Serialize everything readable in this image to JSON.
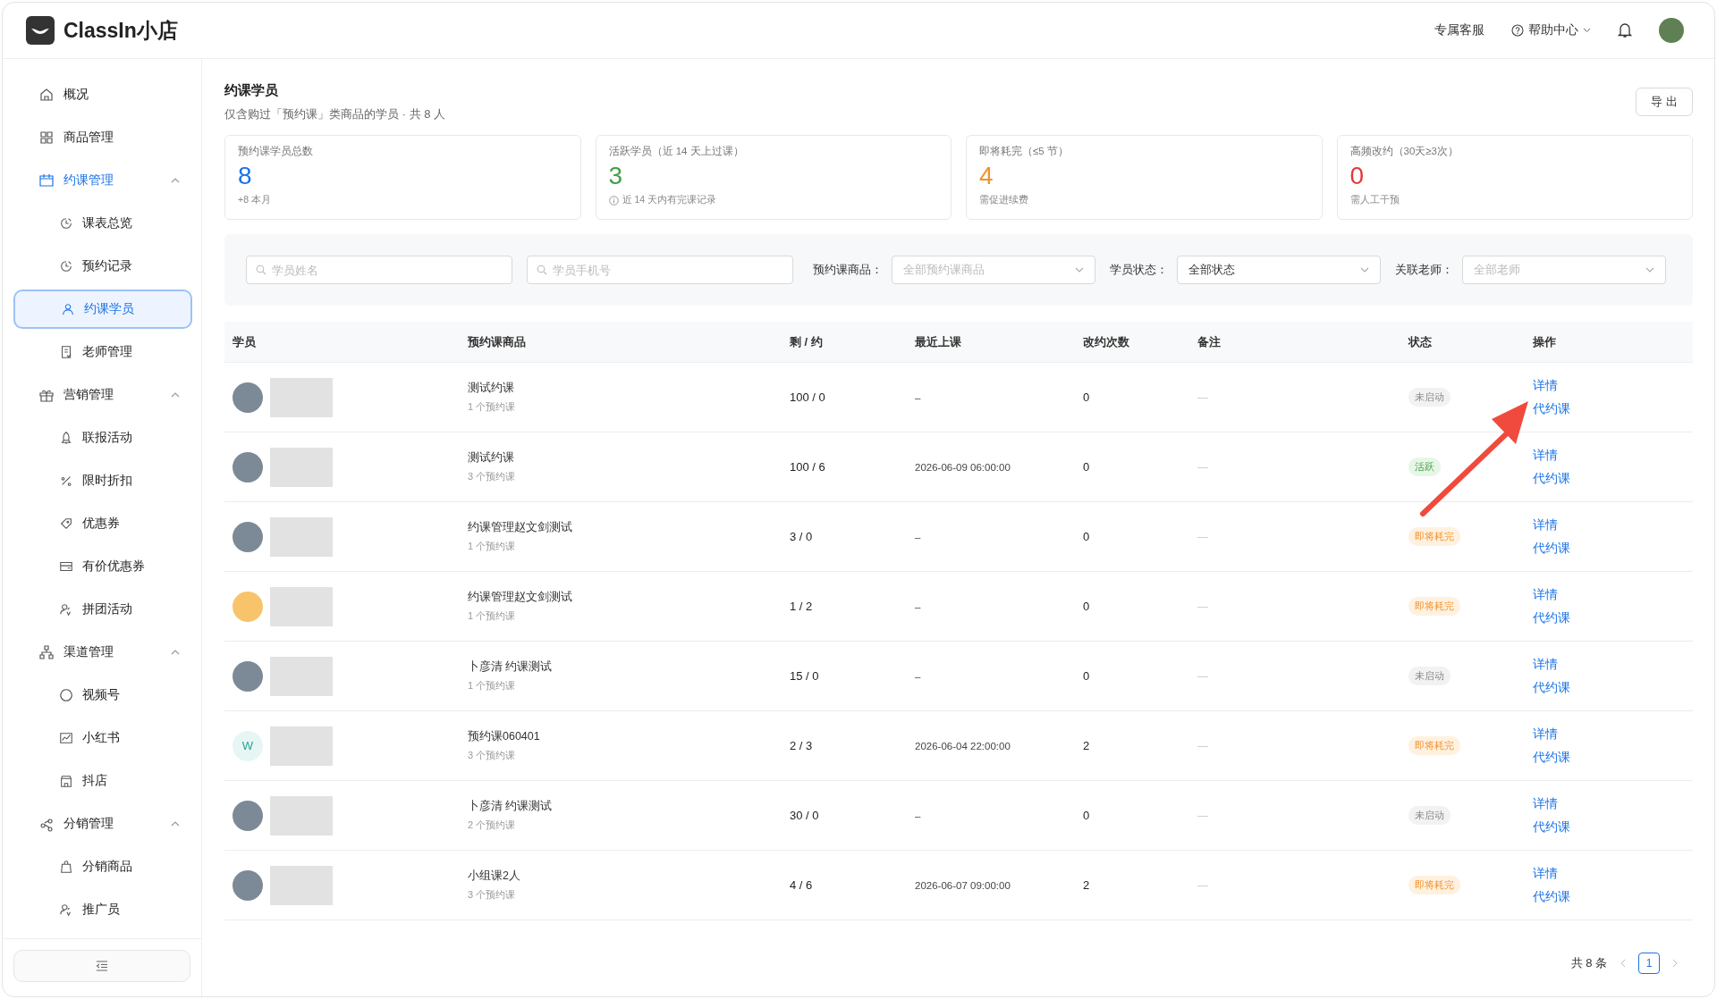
{
  "header": {
    "brand": "ClassIn小店",
    "links": [
      {
        "label": "专属客服",
        "kind": "plain"
      },
      {
        "label": "帮助中心",
        "kind": "help"
      }
    ]
  },
  "sidebar": {
    "items": [
      {
        "label": "概况",
        "selected": false
      },
      {
        "label": "商品管理",
        "selected": false
      },
      {
        "label": "约课管理",
        "expanded": true,
        "children": [
          {
            "label": "课表总览",
            "selected": false
          },
          {
            "label": "预约记录",
            "selected": false
          },
          {
            "label": "约课学员",
            "selected": true
          },
          {
            "label": "老师管理",
            "selected": false
          }
        ]
      },
      {
        "label": "营销管理",
        "expanded": true,
        "children": [
          {
            "label": "联报活动",
            "selected": false
          },
          {
            "label": "限时折扣",
            "selected": false
          },
          {
            "label": "优惠券",
            "selected": false
          },
          {
            "label": "有价优惠券",
            "selected": false
          },
          {
            "label": "拼团活动",
            "selected": false
          }
        ]
      },
      {
        "label": "渠道管理",
        "expanded": true,
        "children": [
          {
            "label": "视频号",
            "selected": false
          },
          {
            "label": "小红书",
            "selected": false
          },
          {
            "label": "抖店",
            "selected": false
          }
        ]
      },
      {
        "label": "分销管理",
        "expanded": true,
        "children": [
          {
            "label": "分销商品",
            "selected": false
          },
          {
            "label": "推广员",
            "selected": false
          }
        ]
      }
    ]
  },
  "page": {
    "title": "约课学员",
    "subtitle": "仅含购过「预约课」类商品的学员 · 共 8 人",
    "export_button": "导 出"
  },
  "stats": [
    {
      "label": "预约课学员总数",
      "value": "8",
      "note": "+8 本月",
      "color": "#1a73e8",
      "note_icon": false
    },
    {
      "label": "活跃学员（近 14 天上过课）",
      "value": "3",
      "note": "近 14 天内有完课记录",
      "color": "#43a047",
      "note_icon": true
    },
    {
      "label": "即将耗完（≤5 节）",
      "value": "4",
      "note": "需促进续费",
      "color": "#f0932b",
      "note_icon": false
    },
    {
      "label": "高频改约（30天≥3次）",
      "value": "0",
      "note": "需人工干预",
      "color": "#e53935",
      "note_icon": false
    }
  ],
  "filters": {
    "searches": [
      {
        "placeholder": "学员姓名"
      },
      {
        "placeholder": "学员手机号"
      }
    ],
    "selects": [
      {
        "label": "预约课商品：",
        "placeholder": "全部预约课商品"
      },
      {
        "label": "学员状态：",
        "value": "全部状态"
      },
      {
        "label": "关联老师：",
        "placeholder": "全部老师"
      }
    ]
  },
  "table": {
    "columns": [
      "学员",
      "预约课商品",
      "剩 / 约",
      "最近上课",
      "改约次数",
      "备注",
      "状态",
      "操作"
    ],
    "rows": [
      {
        "avatar": {
          "kind": "photo"
        },
        "product": "测试约课",
        "product_note": "1 个预约课",
        "remaining": "100 / 0",
        "last_class": "–",
        "reschedules": "0",
        "remark": "—",
        "status": {
          "label": "未启动",
          "kind": "idle"
        },
        "actions": [
          "详情",
          "代约课"
        ]
      },
      {
        "avatar": {
          "kind": "photo"
        },
        "product": "测试约课",
        "product_note": "3 个预约课",
        "remaining": "100 / 6",
        "last_class": "2026-06-09 06:00:00",
        "reschedules": "0",
        "remark": "—",
        "status": {
          "label": "活跃",
          "kind": "active"
        },
        "actions": [
          "详情",
          "代约课"
        ]
      },
      {
        "avatar": {
          "kind": "photo"
        },
        "product": "约课管理赵文剑测试",
        "product_note": "1 个预约课",
        "remaining": "3 / 0",
        "last_class": "–",
        "reschedules": "0",
        "remark": "—",
        "status": {
          "label": "即将耗完",
          "kind": "low"
        },
        "actions": [
          "详情",
          "代约课"
        ]
      },
      {
        "avatar": {
          "kind": "plain"
        },
        "product": "约课管理赵文剑测试",
        "product_note": "1 个预约课",
        "remaining": "1 / 2",
        "last_class": "–",
        "reschedules": "0",
        "remark": "—",
        "status": {
          "label": "即将耗完",
          "kind": "low"
        },
        "actions": [
          "详情",
          "代约课"
        ]
      },
      {
        "avatar": {
          "kind": "photo"
        },
        "product": "卜彦清 约课测试",
        "product_note": "1 个预约课",
        "remaining": "15 / 0",
        "last_class": "–",
        "reschedules": "0",
        "remark": "—",
        "status": {
          "label": "未启动",
          "kind": "idle"
        },
        "actions": [
          "详情",
          "代约课"
        ]
      },
      {
        "avatar": {
          "kind": "initials",
          "text": "W"
        },
        "product": "预约课060401",
        "product_note": "3 个预约课",
        "remaining": "2 / 3",
        "last_class": "2026-06-04 22:00:00",
        "reschedules": "2",
        "remark": "—",
        "status": {
          "label": "即将耗完",
          "kind": "low"
        },
        "actions": [
          "详情",
          "代约课"
        ]
      },
      {
        "avatar": {
          "kind": "photo"
        },
        "product": "卜彦清 约课测试",
        "product_note": "2 个预约课",
        "remaining": "30 / 0",
        "last_class": "–",
        "reschedules": "0",
        "remark": "—",
        "status": {
          "label": "未启动",
          "kind": "idle"
        },
        "actions": [
          "详情",
          "代约课"
        ]
      },
      {
        "avatar": {
          "kind": "photo"
        },
        "product": "小组课2人",
        "product_note": "3 个预约课",
        "remaining": "4 / 6",
        "last_class": "2026-06-07 09:00:00",
        "reschedules": "2",
        "remark": "—",
        "status": {
          "label": "即将耗完",
          "kind": "low"
        },
        "actions": [
          "详情",
          "代约课"
        ]
      }
    ]
  },
  "pagination": {
    "total": "共 8 条",
    "pages": [
      {
        "label": "1",
        "selected": true
      }
    ]
  }
}
